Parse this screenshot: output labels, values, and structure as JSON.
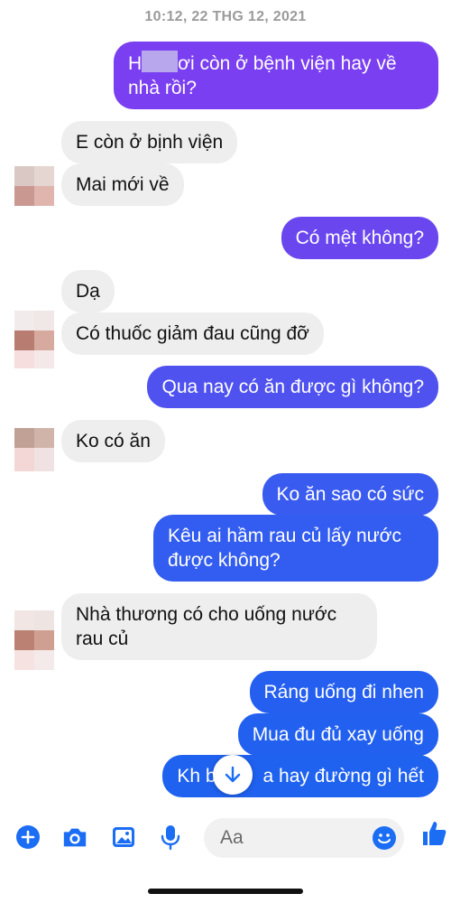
{
  "header": {
    "timestamp": "10:12, 22 THG 12, 2021"
  },
  "colors": {
    "outgoing_top": "#7c3cf0",
    "outgoing_bottom": "#1f62f0",
    "accent": "#1b6ef3"
  },
  "messages": [
    {
      "from": "me",
      "text_prefix": "H",
      "text_suffix": "ơi còn ở bệnh viện hay về nhà rồi?"
    },
    {
      "from": "them",
      "text": "E còn ở bịnh viện"
    },
    {
      "from": "them",
      "text": "Mai mới về"
    },
    {
      "from": "me",
      "text": "Có mệt không?"
    },
    {
      "from": "them",
      "text": "Dạ"
    },
    {
      "from": "them",
      "text": "Có thuốc giảm đau cũng đỡ"
    },
    {
      "from": "me",
      "text": "Qua nay có ăn được gì không?"
    },
    {
      "from": "them",
      "text": "Ko có ăn"
    },
    {
      "from": "me",
      "text": "Ko ăn sao có sức"
    },
    {
      "from": "me",
      "text": "Kêu ai hầm rau củ lấy nước được không?"
    },
    {
      "from": "them",
      "text": "Nhà thương có cho uống nước rau củ"
    },
    {
      "from": "me",
      "text": "Ráng uống đi nhen"
    },
    {
      "from": "me",
      "text": "Mua đu đủ xay uống"
    },
    {
      "from": "me",
      "text_prefix": "Kh b",
      "text_suffix": "a hay đường gì hết"
    }
  ],
  "composer": {
    "placeholder": "Aa"
  },
  "icons": [
    "plus-icon",
    "camera-icon",
    "gallery-icon",
    "microphone-icon",
    "emoji-icon",
    "thumbs-up-icon",
    "arrow-down-icon"
  ]
}
